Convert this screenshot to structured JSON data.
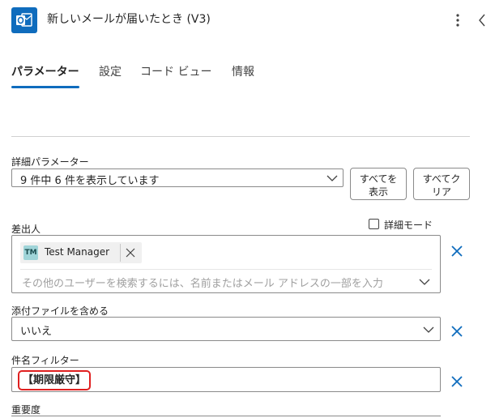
{
  "header": {
    "title": "新しいメールが届いたとき (V3)",
    "icon": "outlook-icon",
    "accent_color": "#0f6cbd"
  },
  "tabs": [
    {
      "label": "パラメーター",
      "active": true
    },
    {
      "label": "設定",
      "active": false
    },
    {
      "label": "コード ビュー",
      "active": false
    },
    {
      "label": "情報",
      "active": false
    }
  ],
  "advanced_params": {
    "label": "詳細パラメーター",
    "value": "9 件中 6 件を表示しています",
    "show_all_label": "すべてを\n表示",
    "clear_all_label": "すべてク\nリア"
  },
  "from": {
    "label": "差出人",
    "detail_mode_label": "詳細モード",
    "detail_mode_checked": false,
    "chip": {
      "initials": "TM",
      "name": "Test Manager"
    },
    "placeholder": "その他のユーザーを検索するには、名前またはメール アドレスの一部を入力"
  },
  "include_attachments": {
    "label": "添付ファイルを含める",
    "value": "いいえ"
  },
  "subject_filter": {
    "label": "件名フィルター",
    "value": "【期限厳守】",
    "highlight_color": "#e02020"
  },
  "importance": {
    "label": "重要度"
  }
}
